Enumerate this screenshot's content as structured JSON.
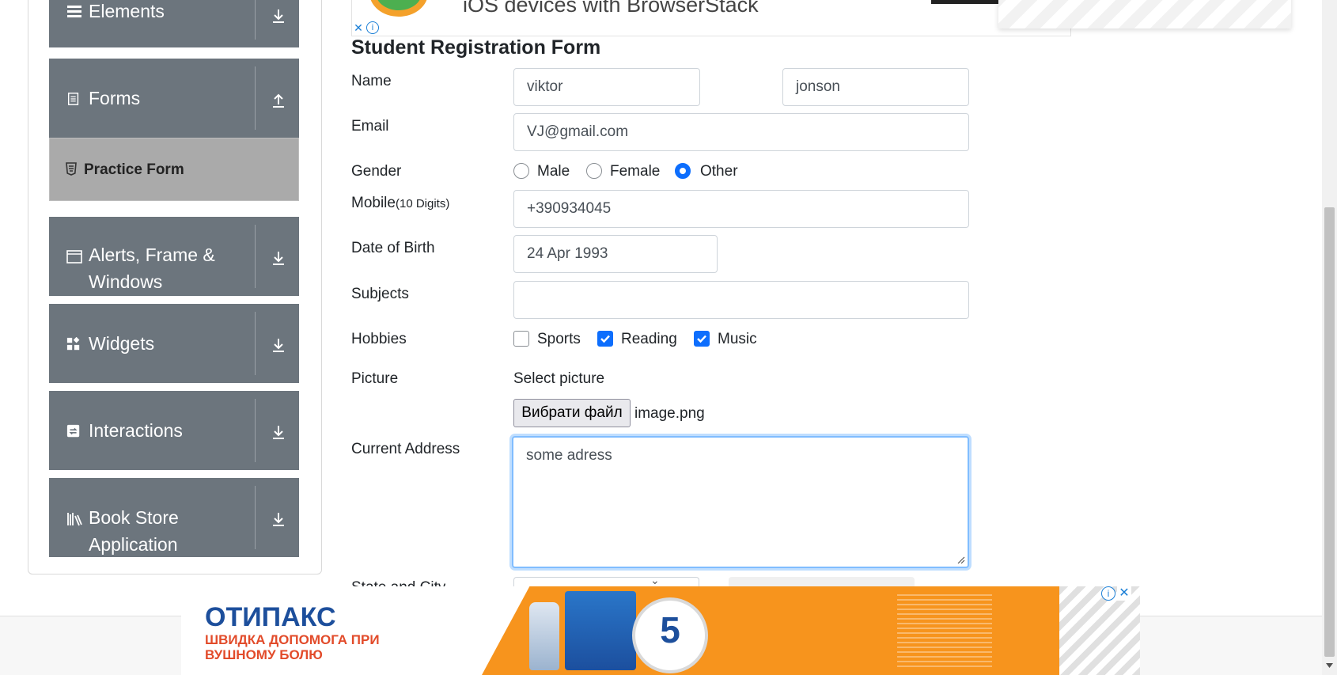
{
  "sidebar": {
    "groups": [
      {
        "label": "Elements",
        "icon": "hamburger-icon"
      },
      {
        "label": "Forms",
        "icon": "document-icon"
      },
      {
        "label": "Alerts, Frame &",
        "label2": "Windows",
        "icon": "window-icon"
      },
      {
        "label": "Widgets",
        "icon": "widgets-icon"
      },
      {
        "label": "Interactions",
        "icon": "interactions-icon"
      },
      {
        "label": "Book Store",
        "label2": "Application",
        "icon": "books-icon"
      }
    ],
    "active_item": "Practice Form"
  },
  "top_ad": {
    "text": "iOS devices with BrowserStack",
    "close": "✕",
    "info": "i"
  },
  "form": {
    "title": "Student Registration Form",
    "name_label": "Name",
    "first_name": "viktor",
    "last_name": "jonson",
    "email_label": "Email",
    "email": "VJ@gmail.com",
    "gender_label": "Gender",
    "genders": [
      "Male",
      "Female",
      "Other"
    ],
    "gender_selected": "Other",
    "mobile_label": "Mobile",
    "mobile_hint": "(10 Digits)",
    "mobile": "+390934045",
    "dob_label": "Date of Birth",
    "dob": "24 Apr 1993",
    "subjects_label": "Subjects",
    "subjects": "",
    "hobbies_label": "Hobbies",
    "hobbies": [
      {
        "label": "Sports",
        "checked": false
      },
      {
        "label": "Reading",
        "checked": true
      },
      {
        "label": "Music",
        "checked": true
      }
    ],
    "picture_label": "Picture",
    "picture_select": "Select picture",
    "file_button": "Вибрати файл",
    "file_name": "image.png",
    "address_label": "Current Address",
    "address": "some adress",
    "state_city_label": "State and City"
  },
  "bottom_ad": {
    "brand": "ОТИПАКС",
    "tagline": "ШВИДКА ДОПОМОГА ПРИ ВУШНОМУ БОЛЮ",
    "badge_number": "5",
    "close": "✕",
    "info": "i"
  },
  "colors": {
    "sidebar_group": "#6c757d",
    "active_item": "#aaaaaa",
    "accent": "#0d6efd",
    "ad_orange": "#f7941d"
  }
}
